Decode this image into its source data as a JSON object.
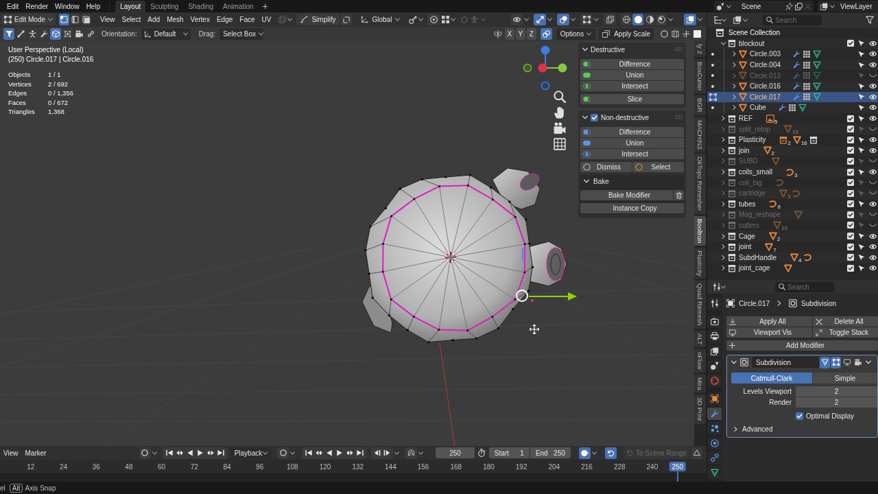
{
  "top_bar": {
    "menus": [
      "Edit",
      "Render",
      "Window",
      "Help"
    ],
    "workspaces": [
      {
        "label": "Layout",
        "selected": true
      },
      {
        "label": "Sculpting",
        "selected": false
      },
      {
        "label": "Shading",
        "selected": false
      },
      {
        "label": "Animation",
        "selected": false
      }
    ],
    "add_workspace": "+",
    "scene": "Scene",
    "view_layer": "ViewLayer"
  },
  "viewport": {
    "header": {
      "mode": "Edit Mode",
      "select_modes": [
        {
          "kind": "vertex",
          "selected": true
        },
        {
          "kind": "edge",
          "selected": false
        },
        {
          "kind": "face",
          "selected": false
        }
      ],
      "menus": [
        "View",
        "Select",
        "Add",
        "Mesh",
        "Vertex",
        "Edge",
        "Face",
        "UV"
      ],
      "simplify": "Simplify",
      "orientation": "Global",
      "display": [
        {
          "kind": "visibility",
          "on": false
        },
        {
          "kind": "gizmo",
          "on": true
        },
        {
          "kind": "overlay",
          "on": true
        },
        {
          "kind": "mesh_overlay",
          "on": false
        },
        {
          "kind": "xray",
          "on": false
        }
      ],
      "shading": [
        {
          "kind": "wireframe",
          "selected": false
        },
        {
          "kind": "solid",
          "selected": true
        },
        {
          "kind": "material",
          "selected": false
        },
        {
          "kind": "rendered",
          "selected": false
        }
      ],
      "addon_toggle": {
        "on": true
      }
    },
    "tool_settings": {
      "tools": [
        {
          "kind": "filter",
          "on": true
        },
        {
          "kind": "bone",
          "on": false
        },
        {
          "kind": "pose",
          "on": false
        },
        {
          "kind": "wrench",
          "on": false
        },
        {
          "kind": "cube",
          "on": true
        },
        {
          "kind": "lattice",
          "on": false
        },
        {
          "kind": "camera",
          "on": false
        },
        {
          "kind": "link",
          "on": false
        }
      ],
      "orientation_label": "Orientation:",
      "orientation": "Default",
      "drag_label": "Drag:",
      "drag": "Select Box",
      "mirror_axes": [
        {
          "label": "X",
          "on": false
        },
        {
          "label": "Y",
          "on": false
        },
        {
          "label": "Z",
          "on": false
        }
      ],
      "auto_merge": {
        "on": true
      },
      "options": "Options",
      "apply_scale": "Apply Scale"
    },
    "info": {
      "view": "User Perspective (Local)",
      "object": "(250) Circle.017 | Circle.016",
      "stats": [
        {
          "label": "Objects",
          "value": "1 / 1"
        },
        {
          "label": "Vertices",
          "value": "2 / 692"
        },
        {
          "label": "Edges",
          "value": "0 / 1,356"
        },
        {
          "label": "Faces",
          "value": "0 / 672"
        },
        {
          "label": "Triangles",
          "value": "1,368"
        }
      ]
    },
    "sidebar": {
      "panels": [
        {
          "kind": "destructive",
          "title": "Destructive",
          "expanded": true,
          "groups": [
            {
              "kind": "column",
              "buttons": [
                {
                  "kind": "difference",
                  "label": "Difference"
                },
                {
                  "kind": "union",
                  "label": "Union"
                },
                {
                  "kind": "intersect",
                  "label": "Intersect"
                }
              ]
            },
            {
              "kind": "column",
              "buttons": [
                {
                  "kind": "slice",
                  "label": "Slice"
                }
              ]
            }
          ]
        },
        {
          "kind": "non_destructive",
          "title": "Non-destructive",
          "expanded": true,
          "checked": true,
          "groups": [
            {
              "kind": "column",
              "buttons": [
                {
                  "kind": "difference",
                  "label": "Difference"
                },
                {
                  "kind": "union",
                  "label": "Union"
                },
                {
                  "kind": "intersect",
                  "label": "Intersect"
                }
              ]
            },
            {
              "kind": "row",
              "buttons": [
                {
                  "kind": "dismiss",
                  "label": "Dismiss"
                },
                {
                  "kind": "select",
                  "label": "Select"
                }
              ]
            }
          ],
          "subpanels": [
            {
              "title": "Bake",
              "expanded": true,
              "buttons": [
                {
                  "kind": "bake",
                  "label": "Bake Modifier"
                },
                {
                  "kind": "instance",
                  "label": "Instance Copy"
                }
              ]
            }
          ]
        }
      ]
    },
    "tabs": [
      {
        "label": "ly 2",
        "selected": false
      },
      {
        "label": "BoxCutter",
        "selected": false
      },
      {
        "label": "BGR",
        "selected": false
      },
      {
        "label": "MACHIN3",
        "selected": false
      },
      {
        "label": "OkTopo Remesher",
        "selected": false
      },
      {
        "label": "Booltron",
        "selected": true
      },
      {
        "label": "Plasticity",
        "selected": false
      },
      {
        "label": "Quad Remesh",
        "selected": false
      },
      {
        "label": "ALT",
        "selected": false
      },
      {
        "label": "nFlow",
        "selected": false
      },
      {
        "label": "Mira",
        "selected": false
      },
      {
        "label": "3D Print",
        "selected": false
      }
    ]
  },
  "outliner": {
    "search_placeholder": "Search",
    "root": "Scene Collection",
    "items": [
      {
        "kind": "collection",
        "name": "blockout",
        "expanded": true,
        "checked": true,
        "hidden": false,
        "selected": false,
        "children": [
          {
            "kind": "mesh",
            "name": "Circle.003",
            "expanded": false,
            "editing": false,
            "hidden": false,
            "selected": false
          },
          {
            "kind": "mesh",
            "name": "Circle.004",
            "expanded": false,
            "editing": false,
            "hidden": false,
            "selected": false
          },
          {
            "kind": "mesh",
            "name": "Circle.013",
            "expanded": false,
            "editing": false,
            "hidden": true,
            "selected": false
          },
          {
            "kind": "mesh",
            "name": "Circle.016",
            "expanded": false,
            "editing": false,
            "hidden": false,
            "selected": false
          },
          {
            "kind": "mesh",
            "name": "Circle.017",
            "expanded": false,
            "editing": true,
            "hidden": false,
            "selected": true
          },
          {
            "kind": "mesh",
            "name": "Cube",
            "expanded": false,
            "editing": false,
            "hidden": false,
            "selected": false
          }
        ]
      },
      {
        "kind": "collection",
        "name": "REF",
        "expanded": false,
        "checked": true,
        "hidden": false,
        "selected": false,
        "contents": [
          {
            "kind": "image",
            "count": "5"
          }
        ]
      },
      {
        "kind": "collection",
        "name": "split_retop",
        "expanded": false,
        "checked": true,
        "hidden": true,
        "selected": false,
        "contents": [
          {
            "kind": "mesh",
            "count": "15"
          }
        ]
      },
      {
        "kind": "collection",
        "name": "Plasticity",
        "expanded": false,
        "checked": true,
        "hidden": false,
        "selected": false,
        "contents": [
          {
            "kind": "instance",
            "count": "2"
          },
          {
            "kind": "mesh",
            "count": "16"
          },
          {
            "kind": "collection"
          }
        ]
      },
      {
        "kind": "collection",
        "name": "join",
        "expanded": false,
        "checked": true,
        "hidden": false,
        "selected": false,
        "contents": [
          {
            "kind": "mesh",
            "count": "2"
          }
        ]
      },
      {
        "kind": "collection",
        "name": "SUBD",
        "expanded": false,
        "checked": true,
        "hidden": true,
        "selected": false,
        "contents": [
          {
            "kind": "mesh"
          }
        ]
      },
      {
        "kind": "collection",
        "name": "coils_small",
        "expanded": false,
        "checked": true,
        "hidden": false,
        "selected": false,
        "contents": [
          {
            "kind": "curve",
            "count": "3"
          }
        ]
      },
      {
        "kind": "collection",
        "name": "coil_big",
        "expanded": false,
        "checked": true,
        "hidden": true,
        "selected": false,
        "contents": [
          {
            "kind": "curve"
          }
        ]
      },
      {
        "kind": "collection",
        "name": "cartridge",
        "expanded": false,
        "checked": true,
        "hidden": true,
        "selected": false,
        "contents": [
          {
            "kind": "mesh",
            "count": "3"
          },
          {
            "kind": "curve"
          }
        ]
      },
      {
        "kind": "collection",
        "name": "tubes",
        "expanded": false,
        "checked": true,
        "hidden": false,
        "selected": false,
        "contents": [
          {
            "kind": "curve",
            "count": "6"
          }
        ]
      },
      {
        "kind": "collection",
        "name": "Mag_reshape",
        "expanded": false,
        "checked": true,
        "hidden": true,
        "selected": false,
        "contents": [
          {
            "kind": "mesh"
          }
        ]
      },
      {
        "kind": "collection",
        "name": "cutters",
        "expanded": false,
        "checked": true,
        "hidden": true,
        "selected": false,
        "contents": [
          {
            "kind": "mesh",
            "count": "10"
          }
        ]
      },
      {
        "kind": "collection",
        "name": "Cage",
        "expanded": false,
        "checked": true,
        "hidden": false,
        "selected": false,
        "contents": [
          {
            "kind": "mesh",
            "count": "2"
          }
        ]
      },
      {
        "kind": "collection",
        "name": "joint",
        "expanded": false,
        "checked": true,
        "hidden": false,
        "selected": false,
        "contents": [
          {
            "kind": "mesh",
            "count": "7"
          }
        ]
      },
      {
        "kind": "collection",
        "name": "SubdHandle",
        "expanded": false,
        "checked": true,
        "hidden": false,
        "selected": false,
        "contents": [
          {
            "kind": "mesh",
            "count": "4"
          },
          {
            "kind": "curve"
          }
        ]
      },
      {
        "kind": "collection",
        "name": "joint_cage",
        "expanded": false,
        "checked": true,
        "hidden": false,
        "selected": false,
        "contents": [
          {
            "kind": "mesh"
          }
        ]
      }
    ]
  },
  "properties": {
    "search_placeholder": "Search",
    "tabs": [
      {
        "kind": "tool",
        "selected": false
      },
      {
        "kind": "render",
        "selected": false
      },
      {
        "kind": "output",
        "selected": false
      },
      {
        "kind": "view_layer",
        "selected": false
      },
      {
        "kind": "scene",
        "selected": false
      },
      {
        "kind": "world",
        "selected": false
      },
      {
        "kind": "object",
        "selected": false
      },
      {
        "kind": "modifiers",
        "selected": true
      },
      {
        "kind": "particles",
        "selected": false
      },
      {
        "kind": "physics",
        "selected": false
      },
      {
        "kind": "constraints",
        "selected": false
      },
      {
        "kind": "data",
        "selected": false
      }
    ],
    "breadcrumb": [
      {
        "kind": "object",
        "label": "Circle.017"
      },
      {
        "kind": "modifier",
        "label": "Subdivision"
      }
    ],
    "actions": [
      {
        "kind": "apply",
        "label": "Apply All"
      },
      {
        "kind": "delete",
        "label": "Delete All"
      },
      {
        "kind": "viewport",
        "label": "Viewport Vis"
      },
      {
        "kind": "stack",
        "label": "Toggle Stack"
      }
    ],
    "add_modifier": "Add Modifier",
    "modifier": {
      "name": "Subdivision",
      "expanded": true,
      "active": true,
      "toggles": [
        {
          "kind": "cage",
          "on": true
        },
        {
          "kind": "edit",
          "on": true
        },
        {
          "kind": "viewport",
          "on": false
        },
        {
          "kind": "render",
          "on": false
        }
      ],
      "types": [
        {
          "label": "Catmull-Clark",
          "selected": true
        },
        {
          "label": "Simple",
          "selected": false
        }
      ],
      "fields": [
        {
          "label": "Levels Viewport",
          "value": "2"
        },
        {
          "label": "Render",
          "value": "2"
        }
      ],
      "optimal_display": {
        "label": "Optimal Display",
        "checked": true
      },
      "advanced": {
        "label": "Advanced",
        "expanded": false
      }
    }
  },
  "timeline": {
    "menus": [
      "View",
      "Marker"
    ],
    "record_toggles": [
      {
        "on": false
      },
      {
        "on": false
      }
    ],
    "playback": "Playback",
    "current_frame": "250",
    "start_label": "Start",
    "start": "1",
    "end_label": "End",
    "end": "250",
    "range_toggles": [
      {
        "kind": "preview",
        "on": true
      },
      {
        "kind": "sync",
        "on": true
      }
    ],
    "scene_range": {
      "label": "To Scene Range",
      "disabled": true
    },
    "ruler": [
      "12",
      "24",
      "36",
      "48",
      "60",
      "72",
      "84",
      "96",
      "108",
      "120",
      "132",
      "144",
      "156",
      "168",
      "180",
      "192",
      "204",
      "216",
      "228",
      "240"
    ],
    "playhead": {
      "label": "250",
      "level": 0.959
    }
  },
  "status_bar": {
    "items": [
      {
        "kind": "text",
        "label": "el"
      },
      {
        "kind": "key",
        "key": "Alt",
        "label": "Axis Snap"
      }
    ]
  }
}
